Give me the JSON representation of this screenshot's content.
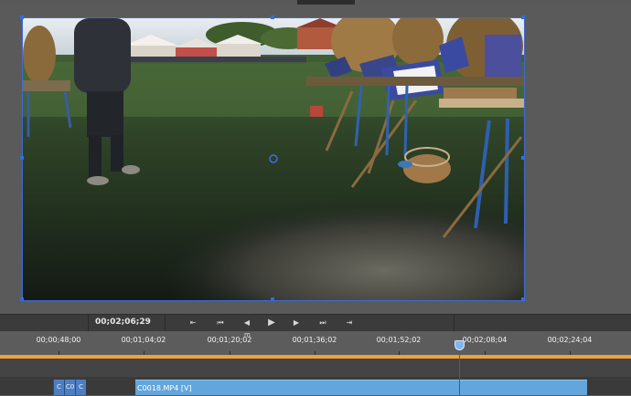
{
  "transport": {
    "timecode": "00;02;06;29",
    "buttons": [
      {
        "name": "go-to-in-point",
        "glyph": "⇤"
      },
      {
        "name": "go-to-previous-edit",
        "glyph": "⏮"
      },
      {
        "name": "step-back",
        "glyph": "◀"
      },
      {
        "name": "play",
        "glyph": "▶"
      },
      {
        "name": "step-forward",
        "glyph": "▶"
      },
      {
        "name": "go-to-next-edit",
        "glyph": "⏭"
      },
      {
        "name": "go-to-out-point",
        "glyph": "⇥"
      }
    ]
  },
  "ruler": {
    "labels": [
      "00;00;48;00",
      "00;01;04;02",
      "00;01;20;02",
      "00;01;36;02",
      "00;01;52;02",
      "00;02;08;04",
      "00;02;24;04"
    ],
    "marker": "m"
  },
  "tracks": {
    "small_clips": [
      "C",
      "C0",
      "C"
    ],
    "main_clip_label": "C0018.MP4 [V]"
  },
  "colors": {
    "accent": "#f0a13c",
    "clip": "#63a6dc",
    "playhead": "#e02020",
    "selection": "#3f6bd1"
  }
}
